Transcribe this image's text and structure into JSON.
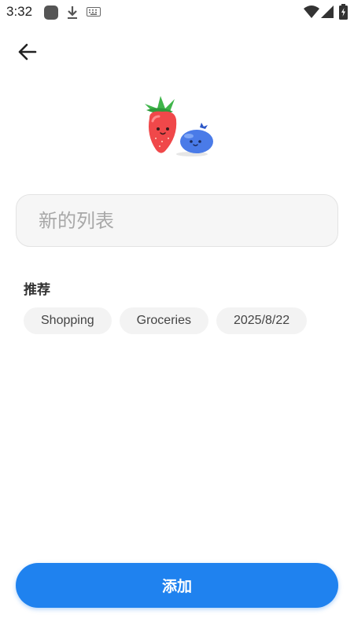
{
  "status_bar": {
    "time": "3:32",
    "icons": [
      "app-notification-icon",
      "download-icon",
      "keyboard-icon",
      "wifi-icon",
      "signal-icon",
      "battery-icon"
    ]
  },
  "header": {
    "back_icon": "arrow-left-icon"
  },
  "illustration": {
    "name": "strawberry-blueberry-illustration"
  },
  "list_name": {
    "placeholder": "新的列表",
    "value": ""
  },
  "recommendations": {
    "title": "推荐",
    "chips": [
      "Shopping",
      "Groceries",
      "2025/8/22"
    ]
  },
  "footer": {
    "add_label": "添加"
  },
  "colors": {
    "accent": "#1f82ef",
    "chip_bg": "#f3f3f3",
    "input_bg": "#f6f6f6"
  }
}
